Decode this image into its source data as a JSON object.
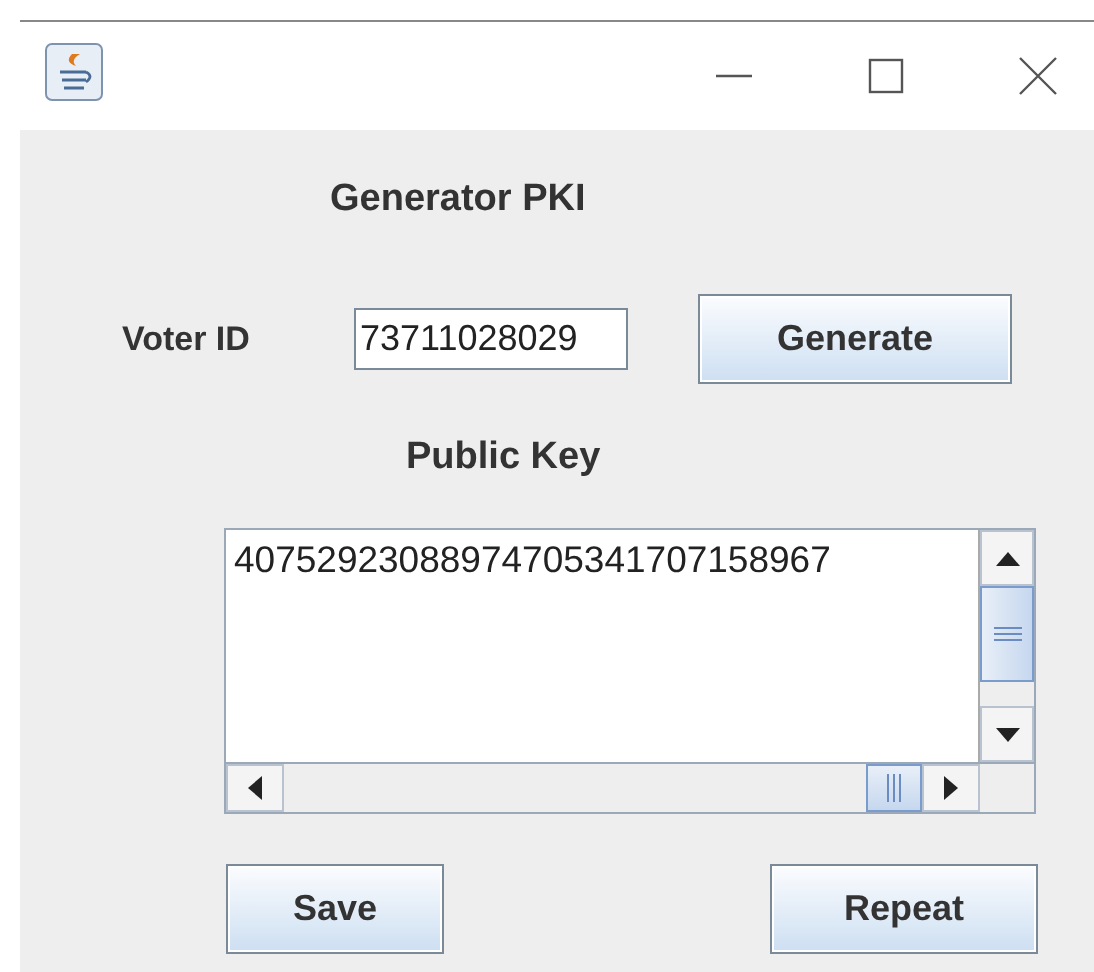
{
  "form": {
    "title": "Generator PKI",
    "voter_id_label": "Voter ID",
    "voter_id_value": "73711028029",
    "generate_button": "Generate",
    "public_key_label": "Public Key",
    "public_key_value": "40752923088974705341707158967"
  },
  "buttons": [
    {
      "label": "Save"
    },
    {
      "label": "Repeat"
    }
  ]
}
